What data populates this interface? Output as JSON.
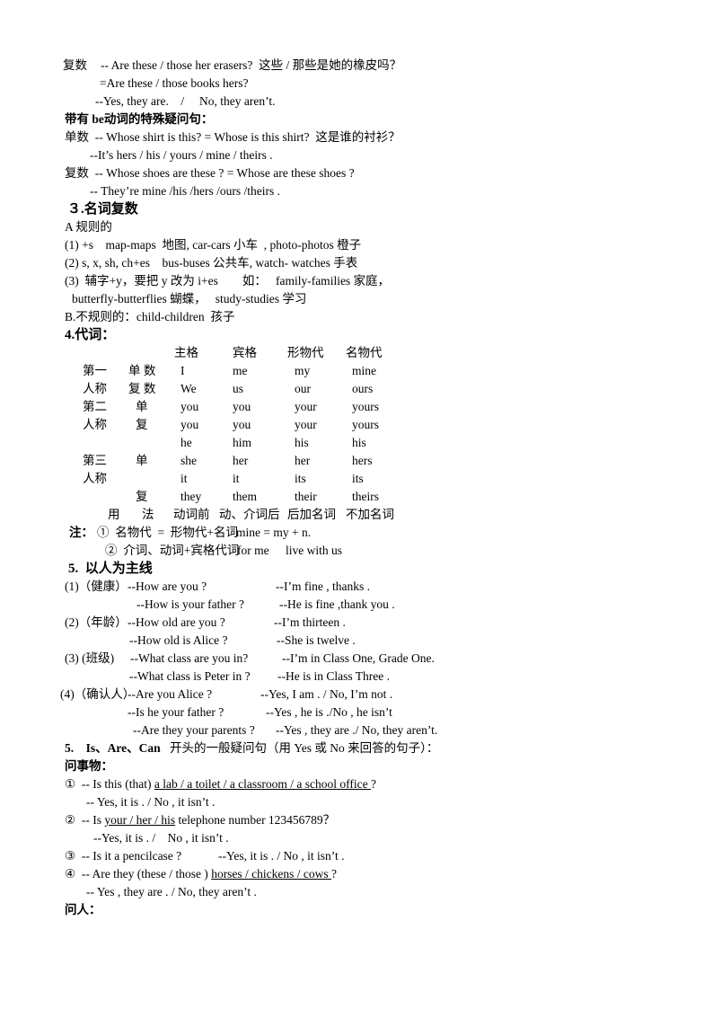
{
  "lines": [
    [
      "复数",
      "-- Are these / those her erasers?  这些 / 那些是她的橡皮吗？"
    ],
    [
      "=Are these / those books hers?"
    ],
    [
      "--Yes, they are.    /     No, they aren’t."
    ],
    [
      "带有 be动词的特殊疑问句："
    ],
    [
      "单数  -- Whose shirt is this? = Whose is this shirt?  这是谁的衬衫？"
    ],
    [
      "--It’s hers / his / yours / mine / theirs ."
    ],
    [
      "复数  -- Whose shoes are these ? = Whose are these shoes ?"
    ],
    [
      "-- They’re mine /his /hers /ours /theirs ."
    ],
    [
      "３.名词复数"
    ],
    [
      "A 规则的"
    ],
    [
      "(1) +s    map-maps  地图, car-cars 小车  , photo-photos 橙子"
    ],
    [
      "(2) s, x, sh, ch+es    bus-buses 公共车, watch- watches 手表"
    ],
    [
      "(3)  辅字+y，要把 y 改为 i+es        如：   family-families 家庭，"
    ],
    [
      "butterfly-butterflies 蝴蝶，   study-studies 学习"
    ],
    [
      "B.不规则的：child-children  孩子"
    ],
    [
      "4.代词："
    ],
    [
      "主格",
      "宾格",
      "形物代",
      "名物代"
    ],
    [
      "第一",
      "单 数",
      "I",
      "me",
      "my",
      "mine"
    ],
    [
      "人称",
      "复 数",
      "We",
      "us",
      "our",
      "ours"
    ],
    [
      "第二",
      "单",
      "you",
      "you",
      "your",
      "yours"
    ],
    [
      "人称",
      "复",
      "you",
      "you",
      "your",
      "yours"
    ],
    [
      "he",
      "him",
      "his",
      "his"
    ],
    [
      "第三",
      "单",
      "she",
      "her",
      "her",
      "hers"
    ],
    [
      "人称",
      "it",
      "it",
      "its",
      "its"
    ],
    [
      "复",
      "they",
      "them",
      "their",
      "theirs"
    ],
    [
      "用",
      "法",
      "动词前",
      "动、介词后",
      "后加名词",
      "不加名词"
    ],
    [
      "注：",
      "①  名物代  =  形物代+名词",
      "mine = my + n."
    ],
    [
      "②  介词、动词+宾格代词",
      "for me",
      "live with us"
    ],
    [
      "5.  以人为主线"
    ],
    [
      "(1)（健康）",
      "--How are you ?",
      "--I’m fine , thanks ."
    ],
    [
      "--How is your father ?",
      "--He is fine ,thank you ."
    ],
    [
      "(2)（年龄）",
      "--How old are you ?",
      "--I’m thirteen ."
    ],
    [
      "--How old is Alice ?",
      "--She is twelve ."
    ],
    [
      "(3) (班级)",
      "--What class are you in?",
      "--I’m in Class One, Grade One."
    ],
    [
      "--What class is Peter in ?",
      "--He is in Class Three ."
    ],
    [
      "(4)（确认人）",
      "--Are you Alice ?",
      "--Yes, I am . / No, I’m not ."
    ],
    [
      "--Is he your father ?",
      "--Yes , he is ./No , he isn’t"
    ],
    [
      "--Are they your parents ?",
      "--Yes , they are ./ No, they aren’t."
    ],
    [
      "5.    Is、Are、Can",
      "开头的一般疑问句（用 Yes 或 No 来回答的句子）："
    ],
    [
      "问事物："
    ],
    [
      [
        {
          "t": "①  -- Is this (that) "
        },
        {
          "t": "a lab / a toilet / a classroom / a school office ",
          "u": true
        },
        {
          "t": "?"
        }
      ]
    ],
    [
      "-- Yes, it is . / No , it isn’t ."
    ],
    [
      [
        {
          "t": "②  -- Is "
        },
        {
          "t": "your / her / his",
          "u": true
        },
        {
          "t": " telephone number 123456789？"
        }
      ]
    ],
    [
      "--Yes, it is . /    No , it isn’t ."
    ],
    [
      "③  -- Is it a pencilcase ?",
      "--Yes, it is . / No , it isn’t ."
    ],
    [
      [
        {
          "t": "④  -- Are they (these / those ) "
        },
        {
          "t": "horses / chickens / cows ",
          "u": true
        },
        {
          "t": "?"
        }
      ]
    ],
    [
      "-- Yes , they are . / No, they aren’t ."
    ],
    [
      "问人："
    ]
  ]
}
